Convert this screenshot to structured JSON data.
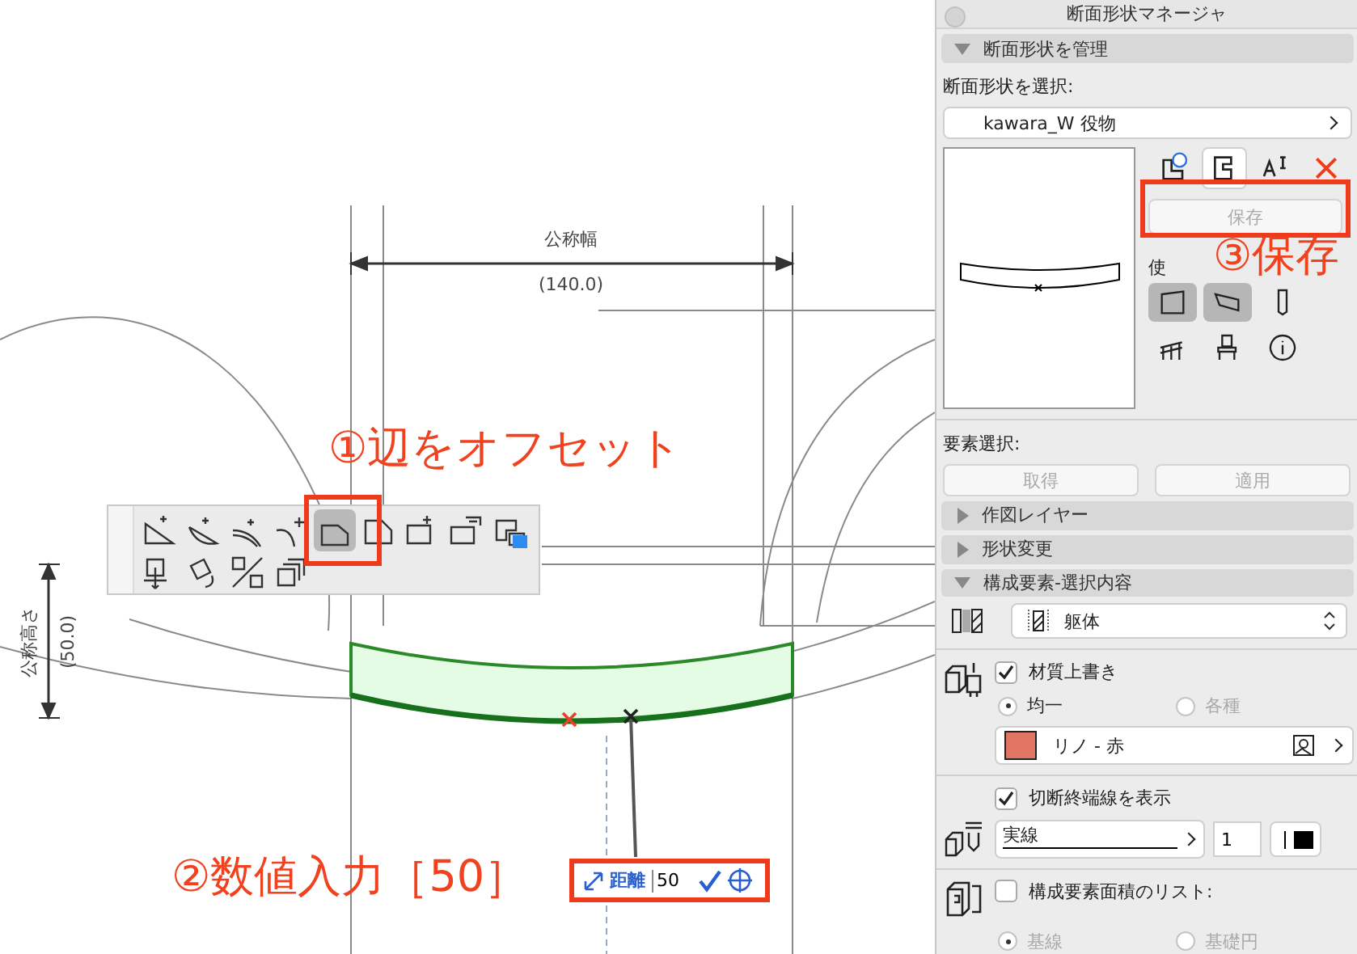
{
  "canvas": {
    "width_dimension": {
      "label": "公称幅",
      "value": "(140.0)"
    },
    "height_dimension": {
      "label": "公称高さ",
      "value": "(50.0)"
    },
    "toolbar": {
      "tools": [
        {
          "selected": false
        },
        {
          "selected": false
        },
        {
          "selected": false
        },
        {
          "selected": false
        },
        {
          "selected": true
        },
        {
          "selected": false
        },
        {
          "selected": false
        },
        {
          "selected": false
        },
        {
          "selected": false
        },
        {
          "selected": false
        },
        {
          "selected": false
        },
        {
          "selected": false
        },
        {
          "selected": false
        }
      ]
    },
    "distance_input": {
      "label": "距離",
      "value": "50"
    },
    "callouts": [
      "①辺をオフセット",
      "②数値入力［50］",
      "③保存"
    ]
  },
  "panel": {
    "title": "断面形状マネージャ",
    "manage_section": {
      "title": "断面形状を管理",
      "expanded": true
    },
    "select_label": "断面形状を選択:",
    "profile_dropdown": "kawara_W 役物",
    "profile_tools": [
      {
        "selected": false
      },
      {
        "selected": true
      },
      {
        "selected": false
      },
      {
        "selected": false
      }
    ],
    "save_button": {
      "label": "保存",
      "disabled": true
    },
    "usage_label": "使",
    "usage_toggles": [
      {
        "selected": true
      },
      {
        "selected": true
      },
      {
        "selected": false
      },
      {
        "selected": false
      },
      {
        "selected": false
      },
      {
        "selected": false
      }
    ],
    "element_select_label": "要素選択:",
    "element_buttons": [
      {
        "label": "取得",
        "disabled": true
      },
      {
        "label": "適用",
        "disabled": true
      }
    ],
    "sections": [
      {
        "title": "作図レイヤー",
        "expanded": false
      },
      {
        "title": "形状変更",
        "expanded": false
      },
      {
        "title": "構成要素-選択内容",
        "expanded": true
      }
    ],
    "building_material": "躯体",
    "override_surface": {
      "label": "材質上書き",
      "checked": true
    },
    "surface_radios": [
      {
        "label": "均一",
        "selected": true,
        "disabled": false
      },
      {
        "label": "各種",
        "selected": false,
        "disabled": true
      }
    ],
    "surface": {
      "name": "リノ - 赤",
      "color": "#e07563"
    },
    "show_cut_end_lines": {
      "label": "切断終端線を表示",
      "checked": true
    },
    "line_type": "実線",
    "pen": "1",
    "component_area_list": {
      "label": "構成要素面積のリスト:",
      "checked": false
    },
    "area_radios": [
      {
        "label": "基線",
        "selected": true,
        "disabled": true
      },
      {
        "label": "基礎円",
        "selected": false,
        "disabled": true
      }
    ]
  }
}
